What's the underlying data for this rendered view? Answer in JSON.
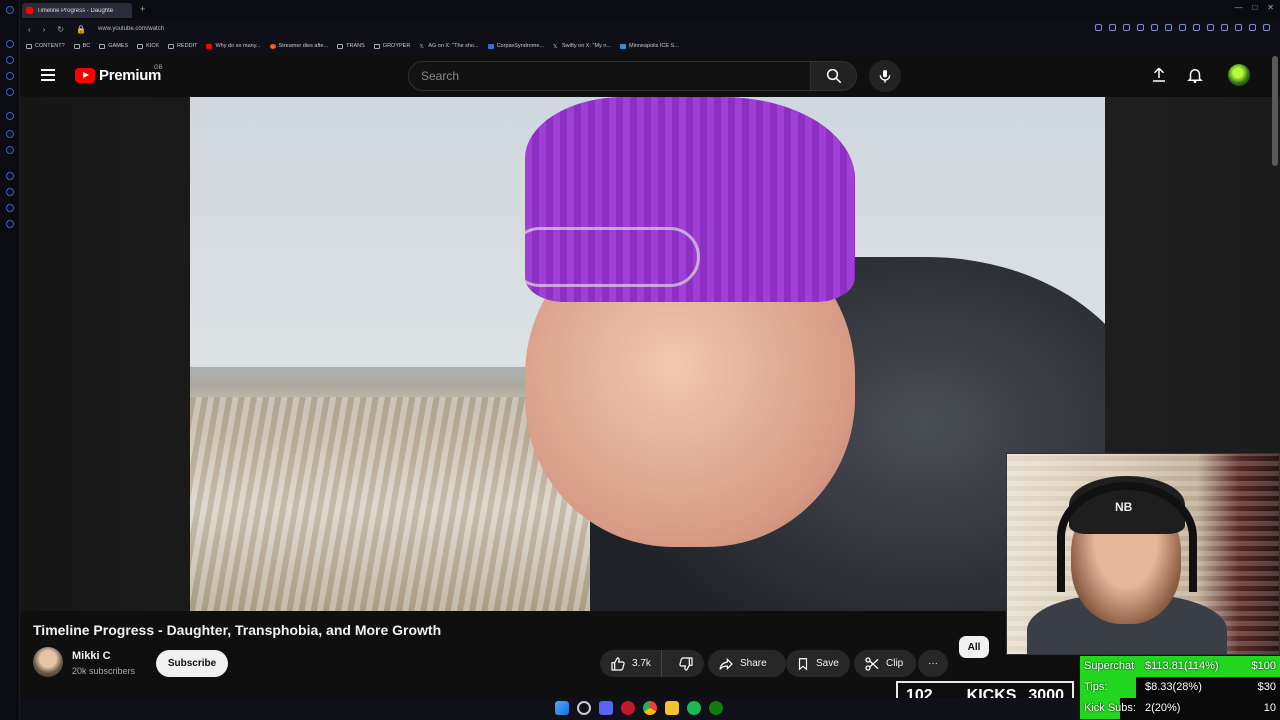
{
  "browser": {
    "tab_title": "Timeline Progress - Daughte",
    "new_tab": "+",
    "url": "www.youtube.com/watch",
    "bookmarks": [
      "CONTENT?",
      "BC",
      "GAMES",
      "KICK",
      "REDDIT",
      "Why do so many...",
      "Streamer dies afte...",
      "TRANS",
      "GROYPER",
      "AG on X: \"The sho...",
      "CorpseSyndrome...",
      "Swifty on X: \"My n...",
      "Minneapolis ICE S..."
    ]
  },
  "header": {
    "logo_text": "Premium",
    "region": "GB",
    "search_placeholder": "Search",
    "icons": {
      "menu": "menu-icon",
      "search": "search-icon",
      "mic": "mic-icon",
      "upload": "upload-icon",
      "notifications": "bell-icon"
    }
  },
  "video": {
    "title": "Timeline Progress - Daughter, Transphobia, and More Growth",
    "channel": "Mikki C",
    "subscribers": "20k subscribers",
    "subscribe_label": "Subscribe",
    "likes": "3.7k",
    "share_label": "Share",
    "save_label": "Save",
    "clip_label": "Clip",
    "more_label": "···"
  },
  "chips": {
    "all": "All"
  },
  "overlay": {
    "kicks_count": "102",
    "kicks_label": "KICKS",
    "kicks_goal": "3000",
    "webcam_cap_logo": "NB",
    "stats": [
      {
        "label": "Superchat",
        "value": "$113.81(114%)",
        "goal": "$100",
        "fill_fraction": 1.0
      },
      {
        "label": "Tips:",
        "value": "$8.33(28%)",
        "goal": "$30",
        "fill_fraction": 0.28
      },
      {
        "label": "Kick Subs:",
        "value": "2(20%)",
        "goal": "10",
        "fill_fraction": 0.2
      }
    ]
  },
  "colors": {
    "youtube_red": "#ff0000",
    "stat_green": "#22d81e",
    "hat_purple": "#9b38d0"
  }
}
